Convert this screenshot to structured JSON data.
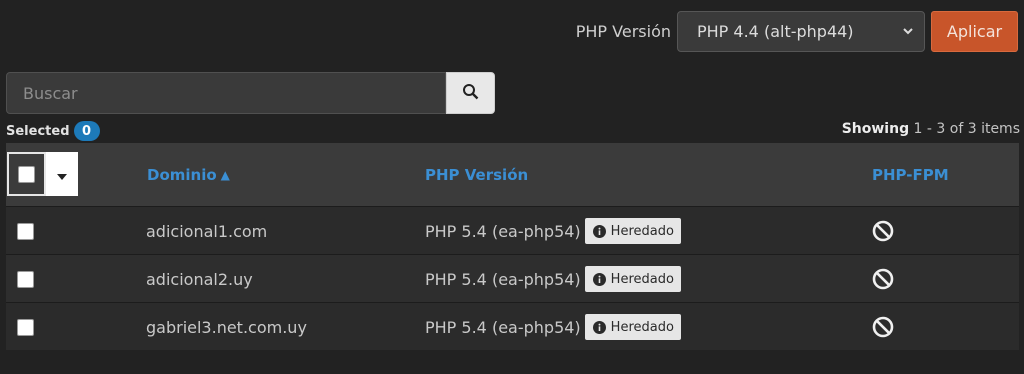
{
  "php_bar": {
    "label": "PHP Versión",
    "selected": "PHP 4.4 (alt-php44)",
    "apply_label": "Aplicar",
    "apply_color": "#c8552a"
  },
  "search": {
    "placeholder": "Buscar",
    "button_icon": "search-icon"
  },
  "selection": {
    "label": "Selected",
    "count": "0"
  },
  "paging": {
    "showing_label": "Showing",
    "range": "1 - 3 of 3 items"
  },
  "table": {
    "columns": {
      "domain": "Dominio",
      "php_version": "PHP Versión",
      "php_fpm": "PHP-FPM"
    },
    "sort_indicator": "▲",
    "header_color": "#3b8fd4",
    "rows": [
      {
        "domain": "adicional1.com",
        "php_version": "PHP 5.4 (ea-php54)",
        "badge": "Heredado",
        "fpm_icon": "ban-icon"
      },
      {
        "domain": "adicional2.uy",
        "php_version": "PHP 5.4 (ea-php54)",
        "badge": "Heredado",
        "fpm_icon": "ban-icon"
      },
      {
        "domain": "gabriel3.net.com.uy",
        "php_version": "PHP 5.4 (ea-php54)",
        "badge": "Heredado",
        "fpm_icon": "ban-icon"
      }
    ]
  }
}
